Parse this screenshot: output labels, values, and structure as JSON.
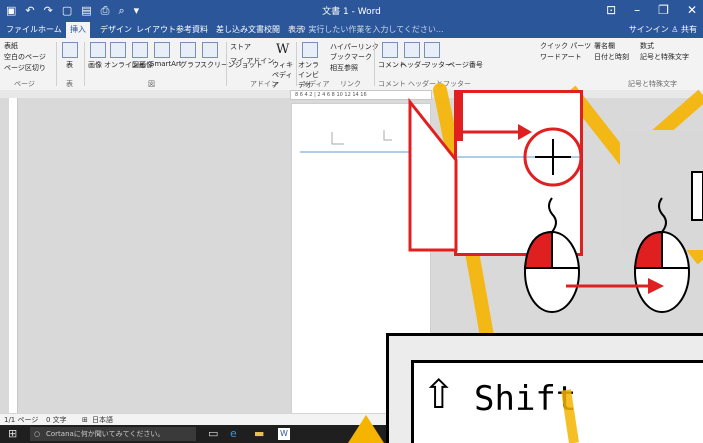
{
  "window": {
    "qat_icons": [
      "save-icon",
      "undo-icon",
      "redo-icon",
      "new-icon",
      "open-icon",
      "print-icon",
      "preview-icon",
      "customize-icon"
    ],
    "title": "文書 1 - Word",
    "controls": [
      "ribbon-display-icon",
      "minimize-icon",
      "maximize-icon",
      "close-icon"
    ],
    "control_glyphs": [
      "⊡",
      "–",
      "❐",
      "✕"
    ]
  },
  "tabs": [
    "ファイル",
    "ホーム",
    "挿入",
    "デザイン",
    "レイアウト",
    "参考資料",
    "差し込み文書",
    "校閲",
    "表示"
  ],
  "tell_me": "♀ 実行したい作業を入力してください...",
  "sign_in": "サインイン",
  "share": "共有",
  "ribbon": {
    "page_items": [
      "表紙",
      "空白のページ",
      "ページ区切り"
    ],
    "groups": [
      "ページ",
      "表",
      "図",
      "アドイン",
      "メディア",
      "リンク",
      "コメント",
      "ヘッダーとフッター",
      "記号と特殊文字"
    ],
    "table": "表",
    "illustrations": [
      "画像",
      "オンライン画像",
      "図形",
      "SmartArt",
      "グラフ",
      "スクリーンショット"
    ],
    "addins": [
      "ストア",
      "マイ アドイン"
    ],
    "wiki": "ウィキペディア",
    "online_video": "オンラインビデオ",
    "links": [
      "ハイパーリンク",
      "ブックマーク",
      "相互参照"
    ],
    "comment": "コメント",
    "header_footer": [
      "ヘッダー",
      "フッター",
      "ページ番号"
    ],
    "text_items": [
      "クイック パーツ",
      "ワードアート",
      "署名欄",
      "日付と時刻"
    ],
    "symbols": [
      "数式",
      "記号と特殊文字"
    ]
  },
  "ruler_ticks": "8 6 4 2 | 2 4 6 8 10 12 14 16",
  "status": {
    "page": "1/1 ページ",
    "words": "0 文字",
    "language": "日本語"
  },
  "taskbar": {
    "cortana": "Cortanaに何か聞いてみてください。"
  },
  "shift_label": "Shift",
  "arrow_char": "⇧",
  "colors": {
    "word_blue": "#2b579a",
    "callout_red": "#e02020",
    "guide_orange": "#f5b400"
  }
}
